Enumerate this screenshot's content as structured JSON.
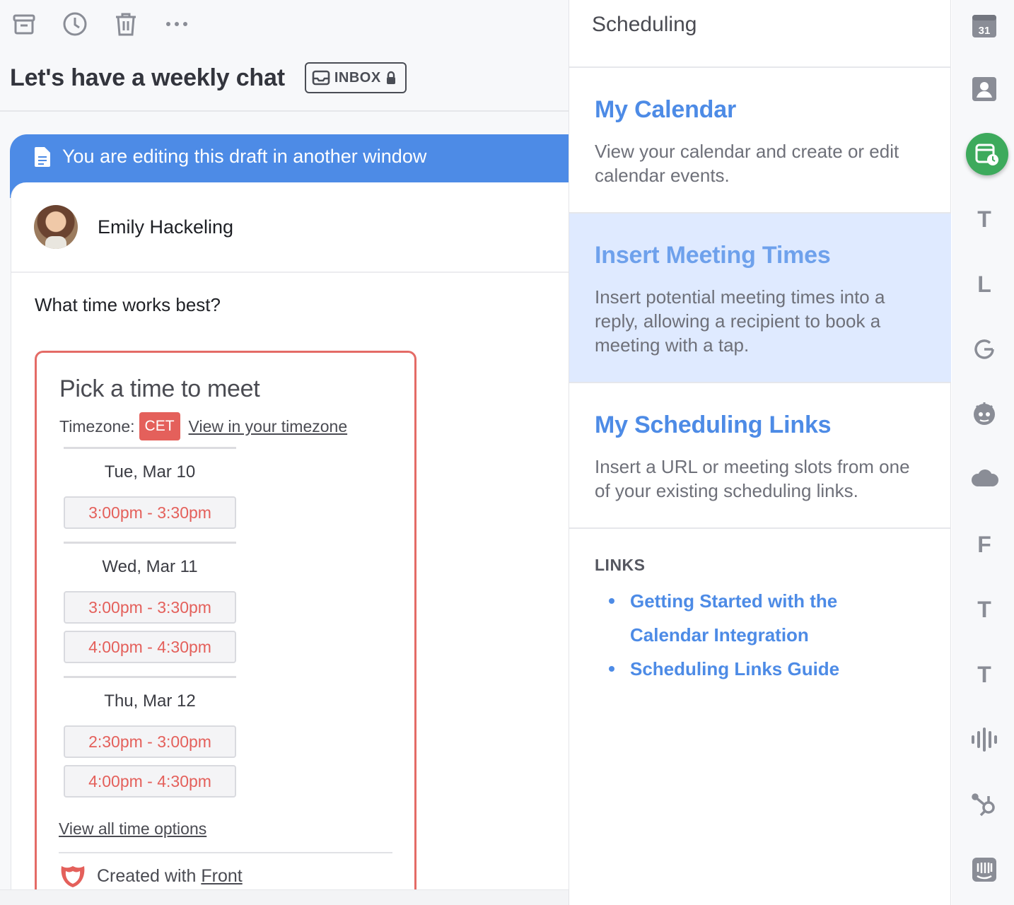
{
  "conversation": {
    "subject": "Let's have a weekly chat",
    "inbox_label": "INBOX",
    "toolbar": [
      "archive-icon",
      "snooze-clock-icon",
      "trash-icon",
      "more-icon"
    ]
  },
  "draft": {
    "banner_text": "You are editing this draft in another window",
    "sender_name": "Emily Hackeling",
    "body_text": "What time works best?"
  },
  "picker": {
    "title": "Pick a time to meet",
    "timezone_label": "Timezone:",
    "timezone": "CET",
    "timezone_link": "View in your timezone",
    "days": [
      {
        "label": "Tue, Mar 10",
        "slots": [
          "3:00pm - 3:30pm"
        ]
      },
      {
        "label": "Wed, Mar 11",
        "slots": [
          "3:00pm - 3:30pm",
          "4:00pm - 4:30pm"
        ]
      },
      {
        "label": "Thu, Mar 12",
        "slots": [
          "2:30pm - 3:00pm",
          "4:00pm - 4:30pm"
        ]
      }
    ],
    "view_all": "View all time options",
    "created_with": "Created with",
    "brand": "Front"
  },
  "panel": {
    "title": "Scheduling",
    "sections": [
      {
        "title": "My Calendar",
        "description": "View your calendar and create or edit calendar events."
      },
      {
        "title": "Insert Meeting Times",
        "description": "Insert potential meeting times into a reply, allowing a recipient to book a meeting with a tap."
      },
      {
        "title": "My Scheduling Links",
        "description": "Insert a URL or meeting slots from one of your existing scheduling links."
      }
    ],
    "links_heading": "LINKS",
    "links": [
      "Getting Started with the Calendar Integration",
      "Scheduling Links Guide"
    ]
  },
  "rail": {
    "calendar_day": "31",
    "letters": {
      "t1": "T",
      "l": "L",
      "f": "F",
      "t2": "T",
      "t3": "T"
    }
  },
  "colors": {
    "accent_blue": "#4d8be6",
    "slot_red": "#e4605b",
    "active_green": "#3daa5c",
    "highlight_bg": "#dfeaff"
  }
}
